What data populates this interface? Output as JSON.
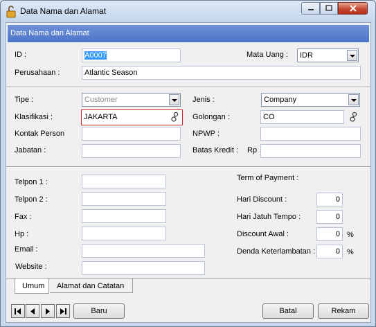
{
  "window": {
    "title": "Data Nama dan Alamat"
  },
  "header": {
    "title": "Data Nama dan Alamat"
  },
  "top": {
    "id_label": "ID :",
    "id_value": "A0007",
    "mata_uang_label": "Mata Uang :",
    "mata_uang_value": "IDR",
    "perusahaan_label": "Perusahaan :",
    "perusahaan_value": "Atlantic Season"
  },
  "mid": {
    "tipe_label": "Tipe :",
    "tipe_value": "Customer",
    "jenis_label": "Jenis :",
    "jenis_value": "Company",
    "klasifikasi_label": "Klasifikasi :",
    "klasifikasi_value": "JAKARTA",
    "golongan_label": "Golongan :",
    "golongan_value": "CO",
    "kontak_label": "Kontak Person",
    "kontak_value": "",
    "npwp_label": "NPWP :",
    "npwp_value": "",
    "jabatan_label": "Jabatan :",
    "jabatan_value": "",
    "batas_label": "Batas Kredit :",
    "batas_currency": "Rp",
    "batas_value": ""
  },
  "contact": {
    "telpon1_label": "Telpon 1 :",
    "telpon2_label": "Telpon 2 :",
    "fax_label": "Fax :",
    "hp_label": "Hp :",
    "email_label": "Email :",
    "website_label": "Website :"
  },
  "payment": {
    "title": "Term of Payment :",
    "hari_discount_label": "Hari Discount :",
    "hari_discount_value": "0",
    "hari_jatuh_label": "Hari Jatuh Tempo :",
    "hari_jatuh_value": "0",
    "discount_awal_label": "Discount Awal :",
    "discount_awal_value": "0",
    "discount_awal_unit": "%",
    "denda_label": "Denda Keterlambatan :",
    "denda_value": "0",
    "denda_unit": "%"
  },
  "tabs": {
    "umum": "Umum",
    "alamat": "Alamat dan Catatan"
  },
  "buttons": {
    "baru": "Baru",
    "batal": "Batal",
    "rekam": "Rekam"
  },
  "colors": {
    "header": "#4c73c8",
    "highlight": "#3399ff",
    "error_border": "#c8282d"
  }
}
